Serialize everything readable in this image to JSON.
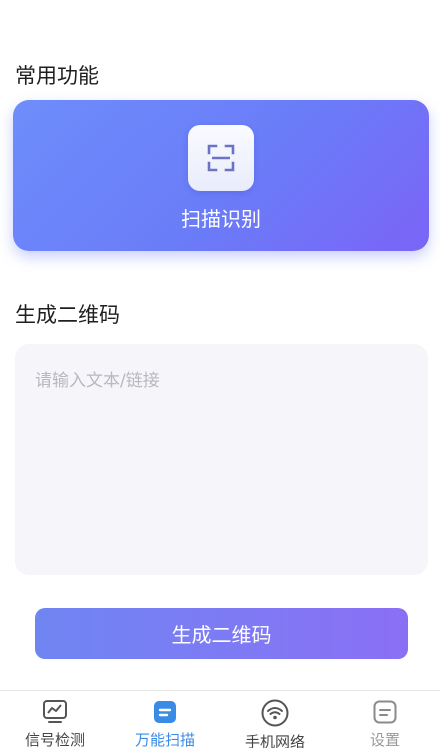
{
  "sections": {
    "common_title": "常用功能",
    "qr_title": "生成二维码"
  },
  "scan_card": {
    "label": "扫描识别",
    "icon": "scan-frame-icon"
  },
  "qr_form": {
    "placeholder": "请输入文本/链接",
    "value": "",
    "button_label": "生成二维码"
  },
  "tabbar": {
    "tabs": [
      {
        "label": "信号检测",
        "icon": "chart-monitor-icon",
        "state": "normal"
      },
      {
        "label": "万能扫描",
        "icon": "scan-doc-icon",
        "state": "active"
      },
      {
        "label": "手机网络",
        "icon": "wifi-icon",
        "state": "normal"
      },
      {
        "label": "设置",
        "icon": "settings-doc-icon",
        "state": "muted"
      }
    ],
    "active_color": "#3a8be6"
  },
  "colors": {
    "accent_start": "#6e8dfb",
    "accent_end": "#8a6ff5"
  }
}
